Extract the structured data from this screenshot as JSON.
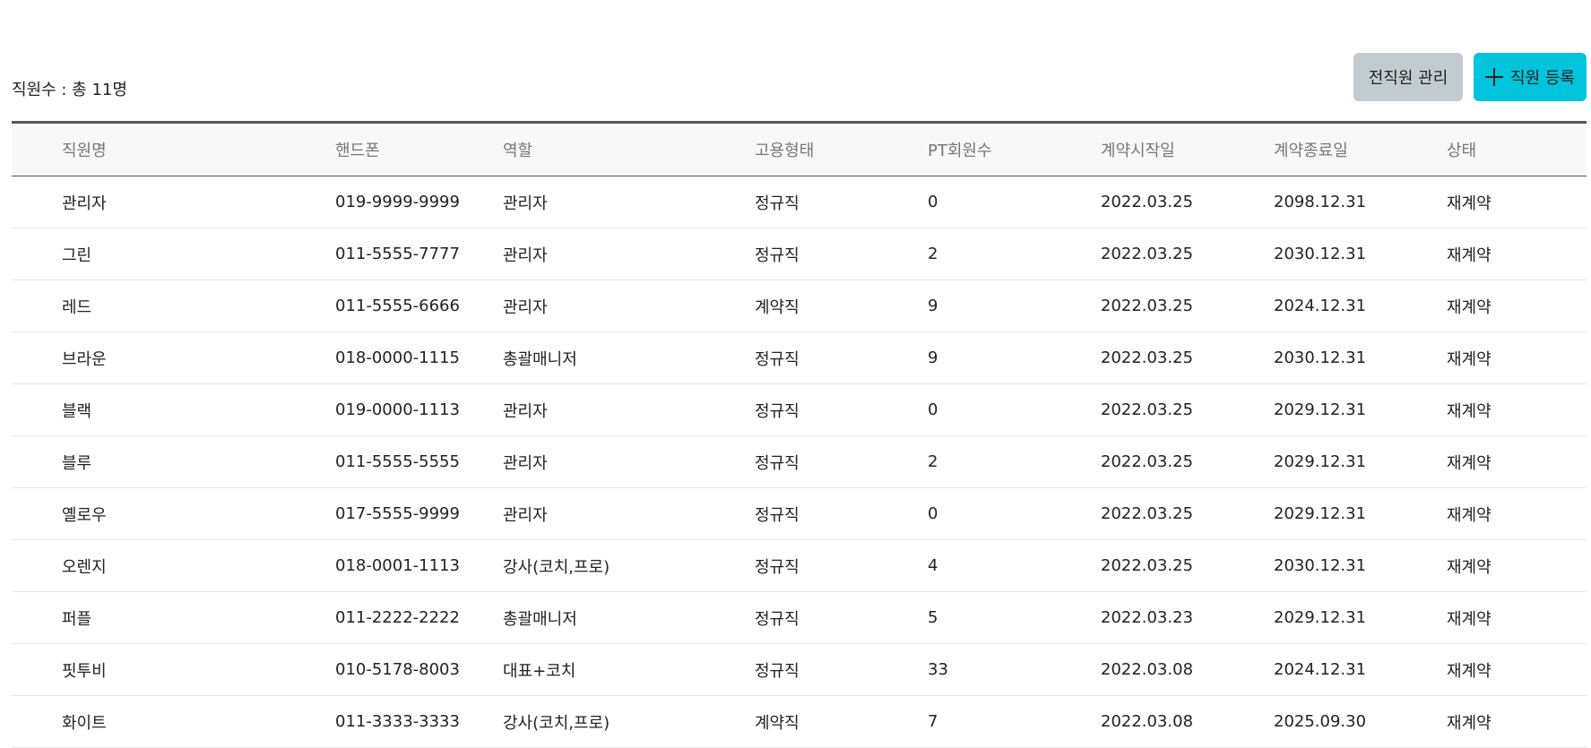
{
  "summary": {
    "staff_count_label": "직원수 : 총 11명"
  },
  "toolbar": {
    "former_staff_label": "전직원 관리",
    "add_staff_label": "직원 등록"
  },
  "table": {
    "headers": [
      "직원명",
      "핸드폰",
      "역할",
      "고용형태",
      "PT회원수",
      "계약시작일",
      "계약종료일",
      "상태"
    ],
    "rows": [
      [
        "관리자",
        "019-9999-9999",
        "관리자",
        "정규직",
        "0",
        "2022.03.25",
        "2098.12.31",
        "재계약"
      ],
      [
        "그린",
        "011-5555-7777",
        "관리자",
        "정규직",
        "2",
        "2022.03.25",
        "2030.12.31",
        "재계약"
      ],
      [
        "레드",
        "011-5555-6666",
        "관리자",
        "계약직",
        "9",
        "2022.03.25",
        "2024.12.31",
        "재계약"
      ],
      [
        "브라운",
        "018-0000-1115",
        "총괄매니저",
        "정규직",
        "9",
        "2022.03.25",
        "2030.12.31",
        "재계약"
      ],
      [
        "블랙",
        "019-0000-1113",
        "관리자",
        "정규직",
        "0",
        "2022.03.25",
        "2029.12.31",
        "재계약"
      ],
      [
        "블루",
        "011-5555-5555",
        "관리자",
        "정규직",
        "2",
        "2022.03.25",
        "2029.12.31",
        "재계약"
      ],
      [
        "옐로우",
        "017-5555-9999",
        "관리자",
        "정규직",
        "0",
        "2022.03.25",
        "2029.12.31",
        "재계약"
      ],
      [
        "오렌지",
        "018-0001-1113",
        "강사(코치,프로)",
        "정규직",
        "4",
        "2022.03.25",
        "2030.12.31",
        "재계약"
      ],
      [
        "퍼플",
        "011-2222-2222",
        "총괄매니저",
        "정규직",
        "5",
        "2022.03.23",
        "2029.12.31",
        "재계약"
      ],
      [
        "핏투비",
        "010-5178-8003",
        "대표+코치",
        "정규직",
        "33",
        "2022.03.08",
        "2024.12.31",
        "재계약"
      ],
      [
        "화이트",
        "011-3333-3333",
        "강사(코치,프로)",
        "계약직",
        "7",
        "2022.03.08",
        "2025.09.30",
        "재계약"
      ]
    ]
  },
  "colors": {
    "add_button_bg": "#00c4dc",
    "former_button_bg": "#c2ccd0",
    "header_bg": "#f8f8f8"
  }
}
